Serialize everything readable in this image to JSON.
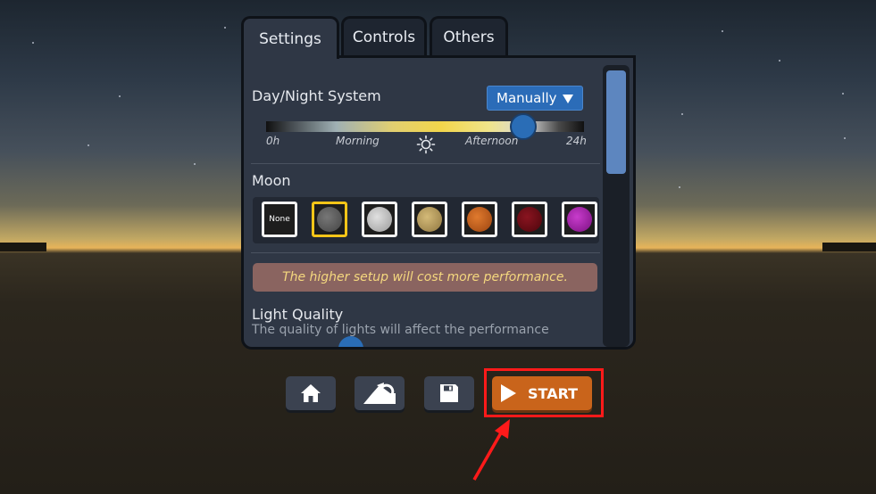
{
  "tabs": [
    {
      "label": "Settings",
      "active": true
    },
    {
      "label": "Controls",
      "active": false
    },
    {
      "label": "Others",
      "active": false
    }
  ],
  "day_night": {
    "label": "Day/Night System",
    "mode_value": "Manually",
    "slider_value_fraction": 0.81,
    "tick_labels": [
      "0h",
      "Morning",
      "Afternoon",
      "24h"
    ],
    "icon": "sun-icon"
  },
  "moon": {
    "label": "Moon",
    "options": [
      {
        "name": "None",
        "color": "#1d1d1d"
      },
      {
        "name": "gray",
        "color": "#5a5a5a"
      },
      {
        "name": "white",
        "color": "#c8c8c8"
      },
      {
        "name": "tan",
        "color": "#b9a060"
      },
      {
        "name": "orange",
        "color": "#c8641e"
      },
      {
        "name": "red",
        "color": "#6a0c12"
      },
      {
        "name": "purple",
        "color": "#b01eb4"
      }
    ],
    "selected": "gray"
  },
  "warning_text": "The higher setup will cost more performance.",
  "light_quality": {
    "label": "Light Quality",
    "description": "The quality of lights will affect the performance"
  },
  "toolbar": {
    "home_icon": "home-icon",
    "reset_icon": "reset-icon",
    "save_icon": "save-icon",
    "start_label": "START"
  },
  "colors": {
    "accent_blue": "#2b6cb8",
    "start_orange": "#c9641b",
    "highlight_red": "#ff1a1a",
    "warning_text": "#f4d77e"
  }
}
